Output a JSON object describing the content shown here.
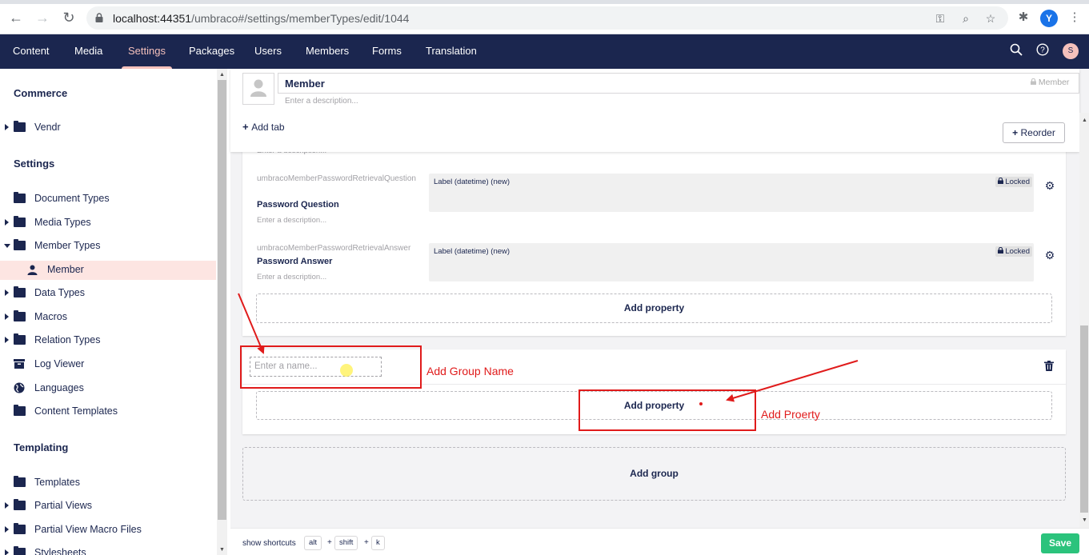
{
  "browser": {
    "url_host": "localhost:44351",
    "url_path": "/umbraco#/settings/memberTypes/edit/1044",
    "profile_initial": "Y"
  },
  "header": {
    "sections": [
      {
        "label": "Content",
        "active": false
      },
      {
        "label": "Media",
        "active": false
      },
      {
        "label": "Settings",
        "active": true
      },
      {
        "label": "Packages",
        "active": false
      },
      {
        "label": "Users",
        "active": false
      },
      {
        "label": "Members",
        "active": false
      },
      {
        "label": "Forms",
        "active": false
      },
      {
        "label": "Translation",
        "active": false
      }
    ],
    "user_initial": "S"
  },
  "sidebar": {
    "commerce_heading": "Commerce",
    "commerce_items": [
      {
        "label": "Vendr",
        "icon": "folder-icon",
        "has_children": true
      }
    ],
    "settings_heading": "Settings",
    "settings_items": [
      {
        "label": "Document Types",
        "icon": "folder-icon",
        "has_children": false
      },
      {
        "label": "Media Types",
        "icon": "folder-icon",
        "has_children": true
      },
      {
        "label": "Member Types",
        "icon": "folder-icon",
        "has_children": true,
        "expanded": true
      },
      {
        "label": "Member",
        "icon": "user-icon",
        "has_children": false,
        "active": true
      },
      {
        "label": "Data Types",
        "icon": "folder-icon",
        "has_children": true
      },
      {
        "label": "Macros",
        "icon": "folder-icon",
        "has_children": true
      },
      {
        "label": "Relation Types",
        "icon": "folder-icon",
        "has_children": true
      },
      {
        "label": "Log Viewer",
        "icon": "box-icon",
        "has_children": false
      },
      {
        "label": "Languages",
        "icon": "globe-icon",
        "has_children": false
      },
      {
        "label": "Content Templates",
        "icon": "folder-icon",
        "has_children": false
      }
    ],
    "templating_heading": "Templating",
    "templating_items": [
      {
        "label": "Templates",
        "icon": "folder-icon",
        "has_children": false
      },
      {
        "label": "Partial Views",
        "icon": "folder-icon",
        "has_children": true
      },
      {
        "label": "Partial View Macro Files",
        "icon": "folder-icon",
        "has_children": true
      },
      {
        "label": "Stylesheets",
        "icon": "folder-icon",
        "has_children": true
      }
    ]
  },
  "editor": {
    "name_value": "Member",
    "alias": "Member",
    "description_placeholder": "Enter a description...",
    "add_tab_label": "Add tab",
    "reorder_label": "Reorder"
  },
  "properties": [
    {
      "alias": "umbracoMemberPasswordRetrievalQuestion",
      "name": "Password Question",
      "description_placeholder": "Enter a description...",
      "editor_label": "Label (datetime) (new)",
      "locked_label": "Locked"
    },
    {
      "alias": "umbracoMemberPasswordRetrievalAnswer",
      "name": "Password Answer",
      "description_placeholder": "Enter a description...",
      "editor_label": "Label (datetime) (new)",
      "locked_label": "Locked"
    }
  ],
  "truncated_description": "Enter a description...",
  "add_property_label": "Add property",
  "new_group": {
    "name_placeholder": "Enter a name...",
    "add_property_label": "Add property"
  },
  "add_group_label": "Add group",
  "footer": {
    "shortcuts_label": "show shortcuts",
    "keys": [
      "alt",
      "shift",
      "k"
    ],
    "save_label": "Save"
  },
  "annotations": {
    "group_name_note": "Add Group Name",
    "property_note": "Add Proerty",
    "color": "#e01b1b"
  },
  "colors": {
    "header_bg": "#1b264f",
    "active_section": "#f5c1bc",
    "save_button": "#2bc37c",
    "active_tree_item": "#fde5e2"
  }
}
